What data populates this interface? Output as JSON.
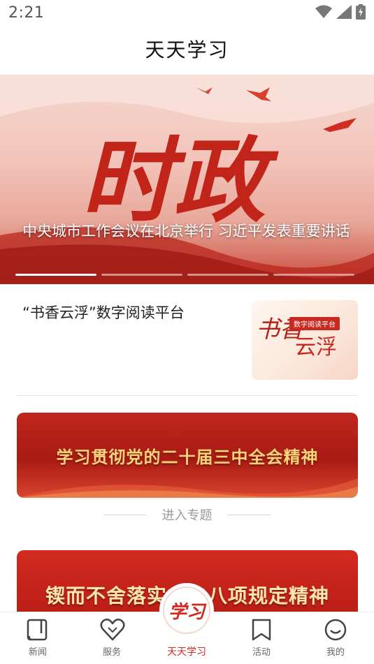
{
  "status_bar": {
    "time": "2:21",
    "icons": [
      "wifi-icon",
      "signal-icon",
      "battery-icon"
    ]
  },
  "header": {
    "title": "天天学习"
  },
  "carousel": {
    "art_text": "时政",
    "caption": "中央城市工作会议在北京举行 习近平发表重要讲话",
    "slide_count": 4,
    "active_index": 0
  },
  "feature": {
    "title": "“书香云浮”数字阅读平台",
    "thumb_label": "数字阅读平台",
    "thumb_calig": "书香",
    "thumb_main": "云浮"
  },
  "banners": [
    {
      "text": "学习贯彻党的二十届三中全会精神"
    },
    {
      "text": "锲而不舍落实中央八项规定精神"
    }
  ],
  "enter_topic": {
    "label": "进入专题"
  },
  "tabbar": {
    "items": [
      {
        "label": "新闻",
        "icon": "news-icon"
      },
      {
        "label": "服务",
        "icon": "heart-icon"
      },
      {
        "label": "天天学习",
        "icon": "study-emblem-icon",
        "emblem_text": "学习"
      },
      {
        "label": "活动",
        "icon": "bookmark-icon"
      },
      {
        "label": "我的",
        "icon": "smile-icon"
      }
    ],
    "active_index": 2
  },
  "colors": {
    "accent": "#d12b24",
    "banner_red": "#b71d15",
    "gold_text": "#f8d57a"
  }
}
